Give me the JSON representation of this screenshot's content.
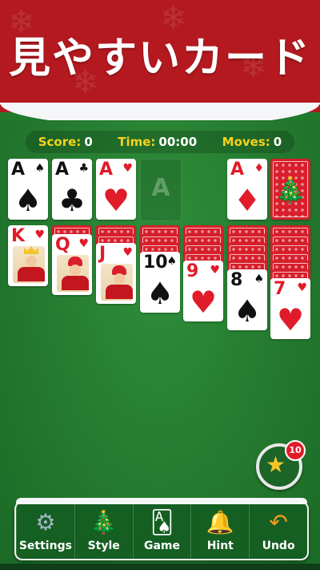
{
  "banner": {
    "title": "見やすいカード"
  },
  "stats": [
    {
      "label": "Score:",
      "value": "0"
    },
    {
      "label": "Time:",
      "value": "00:00"
    },
    {
      "label": "Moves:",
      "value": "0"
    }
  ],
  "foundations": {
    "empty_slot_letter": "A"
  },
  "cards": {
    "ace_spades": {
      "rank": "A",
      "suit": "♠"
    },
    "ace_clubs": {
      "rank": "A",
      "suit": "♣"
    },
    "ace_hearts": {
      "rank": "A",
      "suit": "♥"
    },
    "ace_diamonds": {
      "rank": "A",
      "suit": "♦"
    },
    "king_hearts": {
      "rank": "K",
      "suit": "♥"
    },
    "queen_hearts": {
      "rank": "Q",
      "suit": "♥"
    },
    "jack_hearts": {
      "rank": "J",
      "suit": "♥"
    },
    "ten_spades": {
      "rank": "10",
      "suit": "♠"
    },
    "nine_hearts": {
      "rank": "9",
      "suit": "♥"
    },
    "eight_spades": {
      "rank": "8",
      "suit": "♠"
    },
    "seven_hearts": {
      "rank": "7",
      "suit": "♥"
    }
  },
  "hint_badge": "10",
  "toolbar": [
    {
      "label": "Settings",
      "icon": "gear-icon"
    },
    {
      "label": "Style",
      "icon": "christmas-tree-icon"
    },
    {
      "label": "Game",
      "icon": "cards-icon"
    },
    {
      "label": "Hint",
      "icon": "bell-icon"
    },
    {
      "label": "Undo",
      "icon": "undo-arrow-icon"
    }
  ],
  "colors": {
    "felt": "#247a2f",
    "banner": "#b3191f",
    "stat_label": "#f5d21c",
    "card_red": "#e01b2a"
  }
}
